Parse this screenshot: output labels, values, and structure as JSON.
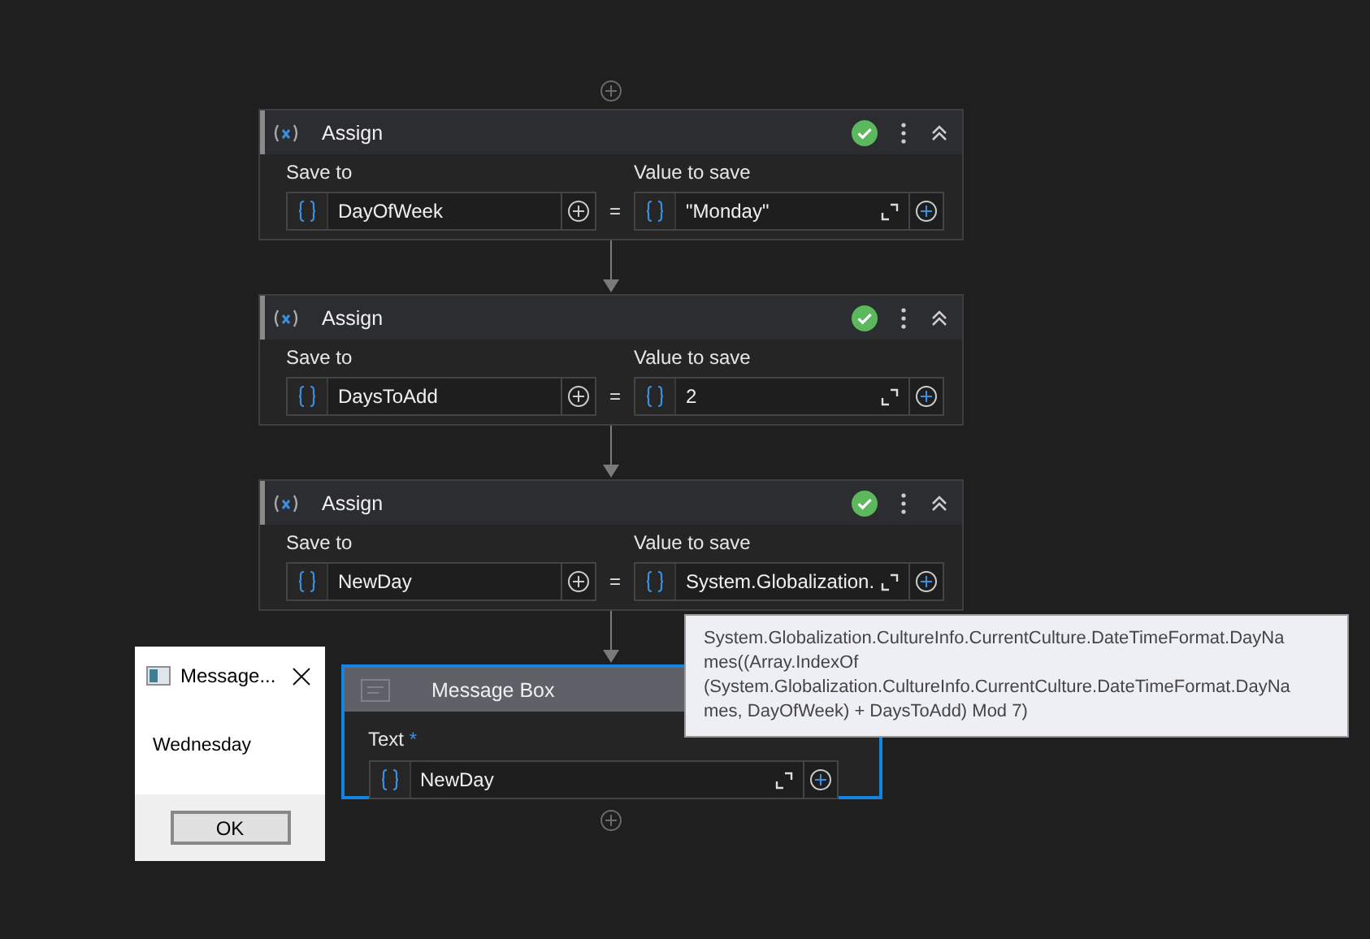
{
  "activities": [
    {
      "kind": "assign",
      "title": "Assign",
      "valid": true,
      "selected": false,
      "save_to_label": "Save to",
      "save_to": "DayOfWeek",
      "equals": "=",
      "value_label": "Value to save",
      "value": "\"Monday\""
    },
    {
      "kind": "assign",
      "title": "Assign",
      "valid": true,
      "selected": false,
      "save_to_label": "Save to",
      "save_to": "DaysToAdd",
      "equals": "=",
      "value_label": "Value to save",
      "value": "2"
    },
    {
      "kind": "assign",
      "title": "Assign",
      "valid": true,
      "selected": false,
      "save_to_label": "Save to",
      "save_to": "NewDay",
      "equals": "=",
      "value_label": "Value to save",
      "value": "System.Globalization."
    },
    {
      "kind": "message_box",
      "title": "Message Box",
      "selected": true,
      "text_label": "Text",
      "required_mark": "*",
      "value": "NewDay"
    }
  ],
  "tooltip": {
    "lines": [
      "System.Globalization.CultureInfo.CurrentCulture.DateTimeFormat.DayNa",
      "mes((Array.IndexOf",
      "(System.Globalization.CultureInfo.CurrentCulture.DateTimeFormat.DayNa",
      "mes, DayOfWeek) + DaysToAdd) Mod 7)"
    ]
  },
  "dialog": {
    "title": "Message...",
    "message": "Wednesday",
    "button": "OK"
  }
}
